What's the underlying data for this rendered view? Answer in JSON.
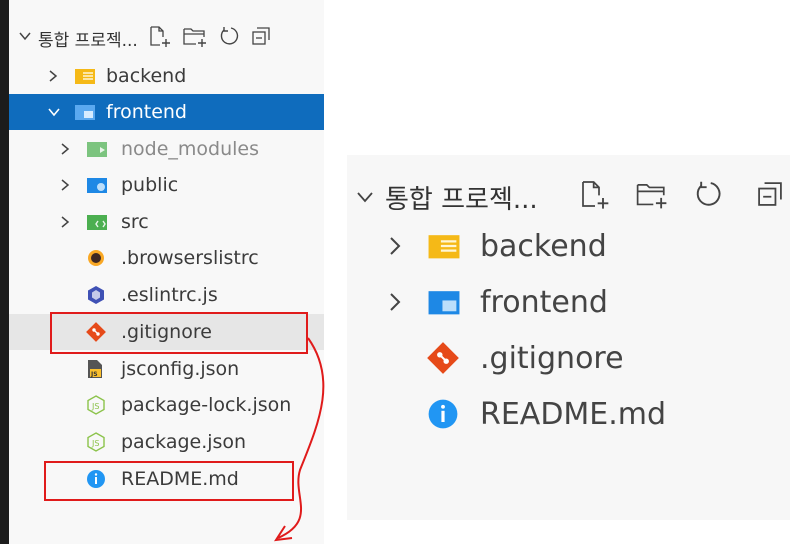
{
  "left_explorer": {
    "title": "통합 프로젝...",
    "items": [
      {
        "label": "backend",
        "icon": "folder-icon",
        "chevron": "right"
      },
      {
        "label": "frontend",
        "icon": "folder-open-icon",
        "chevron": "down",
        "selected": true
      },
      {
        "label": "node_modules",
        "icon": "folder-node-icon",
        "chevron": "right",
        "dimmed": true
      },
      {
        "label": "public",
        "icon": "folder-public-icon",
        "chevron": "right"
      },
      {
        "label": "src",
        "icon": "folder-src-icon",
        "chevron": "right"
      },
      {
        "label": ".browserslistrc",
        "icon": "browserslist-icon"
      },
      {
        "label": ".eslintrc.js",
        "icon": "eslint-icon"
      },
      {
        "label": ".gitignore",
        "icon": "git-icon",
        "hovered": true,
        "highlighted": true
      },
      {
        "label": "jsconfig.json",
        "icon": "js-file-icon"
      },
      {
        "label": "package-lock.json",
        "icon": "node-package-icon"
      },
      {
        "label": "package.json",
        "icon": "node-package-icon"
      },
      {
        "label": "README.md",
        "icon": "info-icon",
        "highlighted": true
      }
    ]
  },
  "right_explorer": {
    "title": "통합 프로젝...",
    "items": [
      {
        "label": "backend",
        "icon": "folder-icon",
        "chevron": "right"
      },
      {
        "label": "frontend",
        "icon": "folder-icon",
        "chevron": "right"
      },
      {
        "label": ".gitignore",
        "icon": "git-icon"
      },
      {
        "label": "README.md",
        "icon": "info-icon"
      }
    ]
  },
  "colors": {
    "selection": "#0f6cbd",
    "annotation_red": "#e01b1b",
    "folder_yellow": "#f5b917",
    "folder_blue": "#1e88e5",
    "git_orange": "#e64a19",
    "info_blue": "#2196f3",
    "node_green": "#66bb6a"
  }
}
